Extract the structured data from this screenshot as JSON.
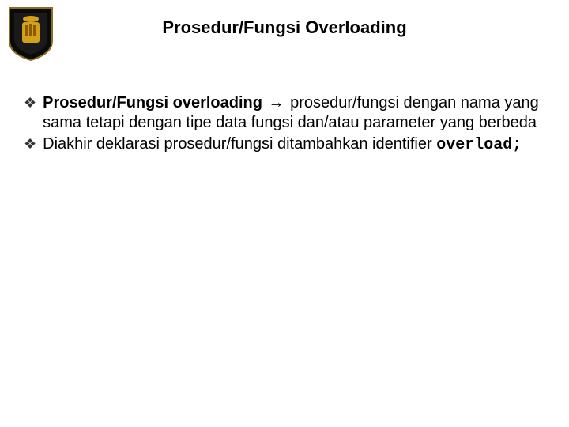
{
  "title": "Prosedur/Fungsi Overloading",
  "bullets": [
    {
      "lead": "Prosedur/Fungsi overloading",
      "arrow": "→",
      "rest": " prosedur/fungsi dengan nama yang sama tetapi dengan tipe data fungsi dan/atau parameter yang berbeda"
    },
    {
      "text_before_code": "Diakhir deklarasi prosedur/fungsi ditambahkan identifier ",
      "code": "overload;"
    }
  ],
  "icons": {
    "diamond_bullet": "❖"
  }
}
